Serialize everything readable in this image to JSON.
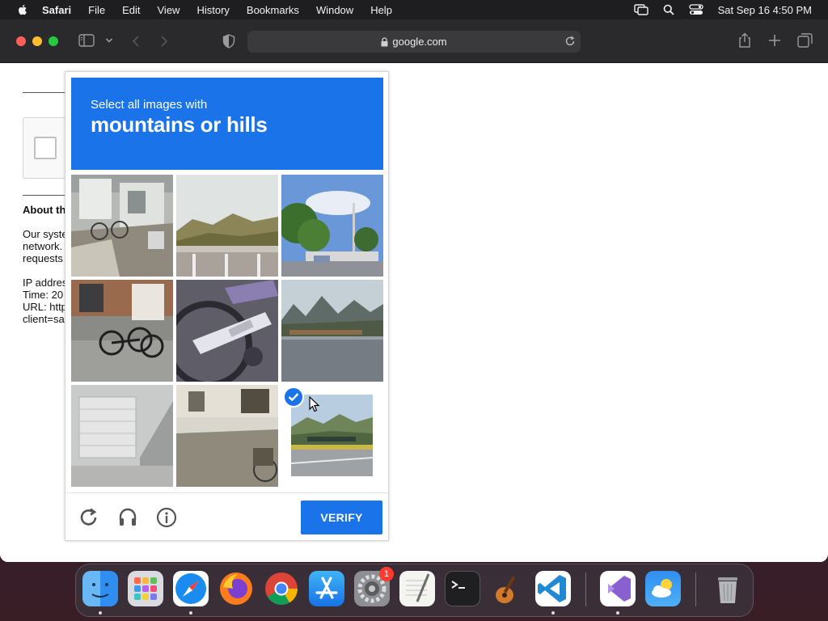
{
  "menubar": {
    "items": [
      "Safari",
      "File",
      "Edit",
      "View",
      "History",
      "Bookmarks",
      "Window",
      "Help"
    ],
    "clock": "Sat Sep 16  4:50 PM"
  },
  "browser": {
    "url": "google.com"
  },
  "page": {
    "about_title": "About th",
    "about_lines": [
      "Our syste",
      "network.",
      "requests"
    ],
    "info_lines": [
      "IP addres",
      "Time: 20",
      "URL: http",
      "client=sa"
    ]
  },
  "captcha": {
    "instruction": "Select all images with",
    "target": "mountains or hills",
    "verify_label": "VERIFY",
    "tiles": [
      {
        "subject": "house-bikes",
        "selected": false
      },
      {
        "subject": "hills-bridge",
        "selected": false
      },
      {
        "subject": "street-trees",
        "selected": false
      },
      {
        "subject": "parked-bicycles",
        "selected": false
      },
      {
        "subject": "bicycle-closeup",
        "selected": false
      },
      {
        "subject": "mountains-river",
        "selected": false
      },
      {
        "subject": "garage-door",
        "selected": false
      },
      {
        "subject": "street-scene",
        "selected": false
      },
      {
        "subject": "hills-road",
        "selected": true
      }
    ]
  },
  "dock": {
    "apps": [
      "Finder",
      "Launchpad",
      "Safari",
      "Firefox",
      "Chrome",
      "App Store",
      "System Settings",
      "TextEdit",
      "Terminal",
      "GarageBand",
      "Visual Studio Code",
      "Visual Studio",
      "Weather",
      "Trash"
    ],
    "settings_badge": "1"
  },
  "colors": {
    "accent": "#1a73e8",
    "menubar_bg": "#1e1e20",
    "toolbar_bg": "#2a2a2c"
  }
}
